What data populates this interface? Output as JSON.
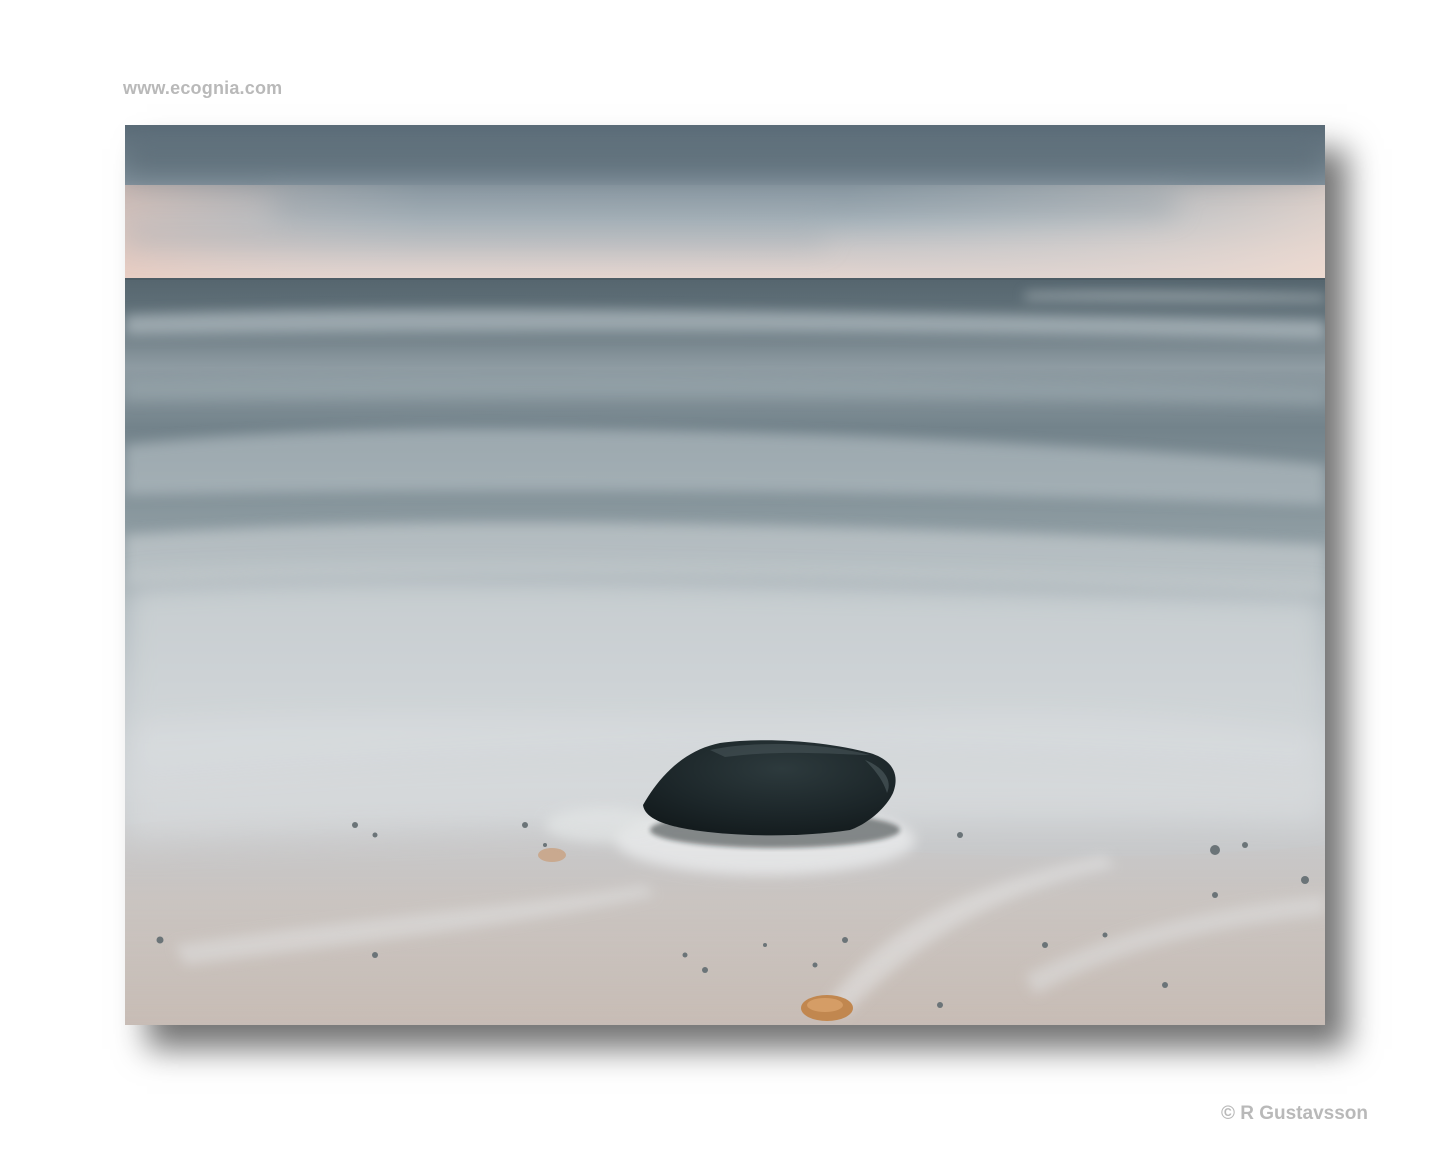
{
  "site_url": "www.ecognia.com",
  "credit": "© R Gustavsson",
  "photo": {
    "subject": "dark-rock-on-beach-with-blurred-waves",
    "colors": {
      "sky_top": "#5e6f7a",
      "sky_glow": "#e6cfc6",
      "sea_dark": "#5b6b73",
      "foam": "#d7dbdd",
      "sand": "#c9c2bd",
      "rock": "#1c2628"
    }
  }
}
